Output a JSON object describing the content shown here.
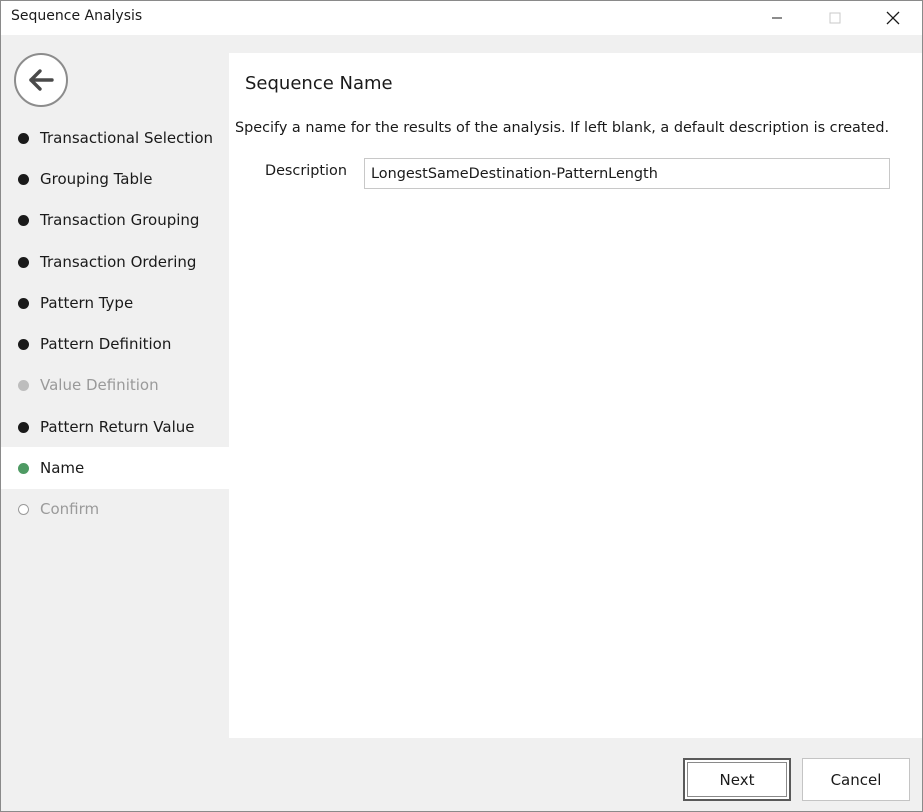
{
  "window": {
    "title": "Sequence Analysis"
  },
  "sidebar": {
    "steps": [
      {
        "label": "Transactional Selection",
        "state": "done"
      },
      {
        "label": "Grouping Table",
        "state": "done"
      },
      {
        "label": "Transaction Grouping",
        "state": "done"
      },
      {
        "label": "Transaction Ordering",
        "state": "done"
      },
      {
        "label": "Pattern Type",
        "state": "done"
      },
      {
        "label": "Pattern Definition",
        "state": "done"
      },
      {
        "label": "Value Definition",
        "state": "disabled"
      },
      {
        "label": "Pattern Return Value",
        "state": "done"
      },
      {
        "label": "Name",
        "state": "current"
      },
      {
        "label": "Confirm",
        "state": "pending"
      }
    ]
  },
  "main": {
    "title": "Sequence Name",
    "instructions": "Specify a name for the results of the analysis. If left blank, a default description is created.",
    "description_label": "Description",
    "description_value": "LongestSameDestination-PatternLength"
  },
  "footer": {
    "next_label": "Next",
    "cancel_label": "Cancel"
  },
  "colors": {
    "current_step": "#4e9a63",
    "done_step": "#1a1a1a",
    "disabled_step": "#bdbdbd"
  },
  "icons": {
    "back": "arrow-left-icon",
    "minimize": "minimize-icon",
    "maximize": "maximize-icon",
    "close": "close-icon"
  }
}
